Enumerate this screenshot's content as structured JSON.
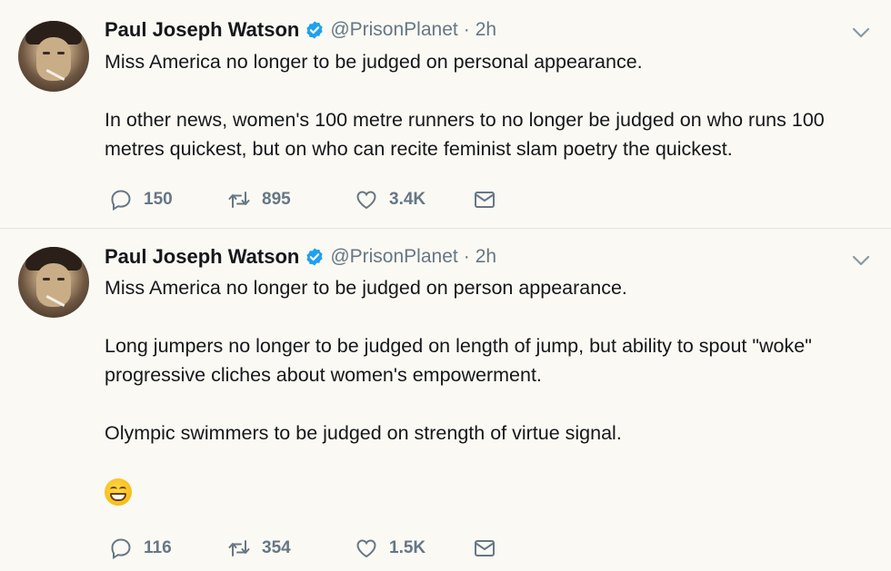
{
  "tweets": [
    {
      "name": "Paul Joseph Watson",
      "handle": "@PrisonPlanet",
      "separator": "·",
      "time": "2h",
      "paragraphs": [
        "Miss America no longer to be judged on personal appearance.",
        "",
        "In other news, women's 100 metre runners to no longer be judged on who runs 100 metres quickest, but on who can recite feminist slam poetry the quickest."
      ],
      "replies": "150",
      "retweets": "895",
      "likes": "3.4K"
    },
    {
      "name": "Paul Joseph Watson",
      "handle": "@PrisonPlanet",
      "separator": "·",
      "time": "2h",
      "paragraphs": [
        "Miss America no longer to be judged on person appearance.",
        "",
        "Long jumpers no longer to be judged on length of jump, but ability to spout \"woke\" progressive cliches about women's empowerment.",
        "",
        "Olympic swimmers to be judged on strength of virtue signal.",
        ""
      ],
      "emoji": "grinning-squinting-face",
      "replies": "116",
      "retweets": "354",
      "likes": "1.5K"
    }
  ],
  "colors": {
    "background": "#fbf9f3",
    "text": "#14171a",
    "muted": "#657786",
    "verified": "#1da1f2"
  },
  "icons": [
    "chevron-down-icon",
    "verified-badge-icon",
    "reply-icon",
    "retweet-icon",
    "like-icon",
    "direct-message-icon"
  ]
}
